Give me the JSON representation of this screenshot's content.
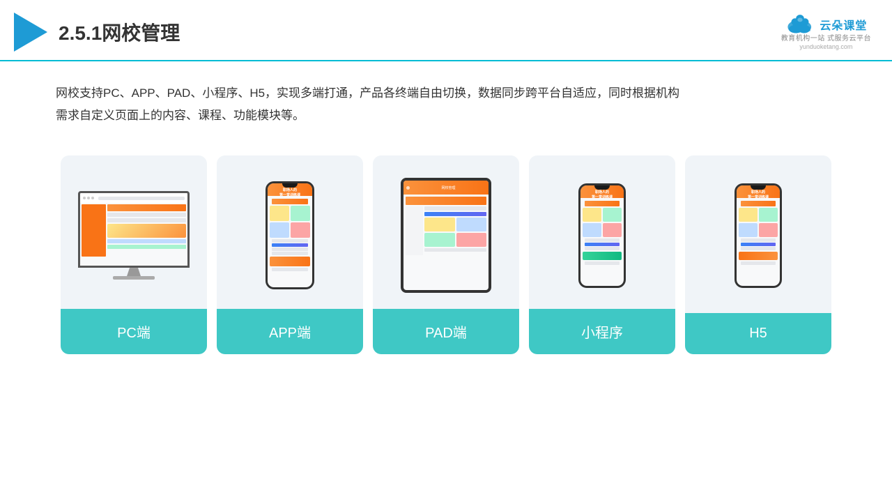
{
  "header": {
    "title": "2.5.1网校管理",
    "brand_name": "云朵课堂",
    "brand_url": "yunduoketang.com",
    "brand_slogan_line1": "教育机构一站",
    "brand_slogan_line2": "式服务云平台"
  },
  "description": {
    "text": "网校支持PC、APP、PAD、小程序、H5，实现多端打通，产品各终端自由切换，数据同步跨平台自适应，同时根据机构需求自定义页面上的内容、课程、功能模块等。"
  },
  "cards": [
    {
      "id": "pc",
      "label": "PC端"
    },
    {
      "id": "app",
      "label": "APP端"
    },
    {
      "id": "pad",
      "label": "PAD端"
    },
    {
      "id": "miniapp",
      "label": "小程序"
    },
    {
      "id": "h5",
      "label": "H5"
    }
  ]
}
